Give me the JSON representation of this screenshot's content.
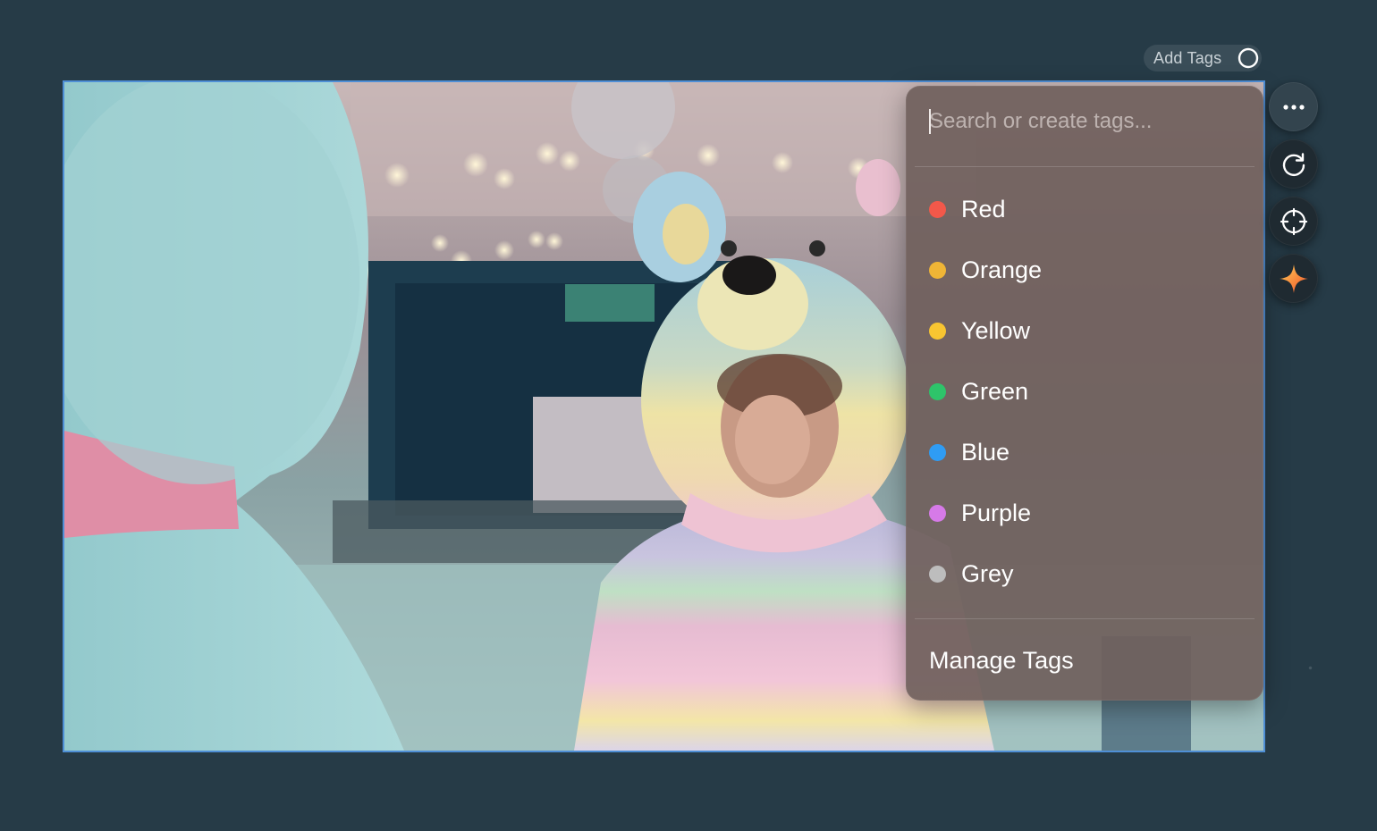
{
  "toolbar": {
    "add_tags_label": "Add Tags"
  },
  "tag_menu": {
    "search_placeholder": "Search or create tags...",
    "search_value": "",
    "tags": [
      {
        "label": "Red",
        "color": "#f2584a"
      },
      {
        "label": "Orange",
        "color": "#efb536"
      },
      {
        "label": "Yellow",
        "color": "#f8c531"
      },
      {
        "label": "Green",
        "color": "#2ec46a"
      },
      {
        "label": "Blue",
        "color": "#2f9cf4"
      },
      {
        "label": "Purple",
        "color": "#d67ae8"
      },
      {
        "label": "Grey",
        "color": "#bdbdbd"
      }
    ],
    "manage_label": "Manage Tags"
  },
  "side_actions": [
    {
      "icon": "more-horizontal-icon"
    },
    {
      "icon": "refresh-icon"
    },
    {
      "icon": "crosshair-icon"
    },
    {
      "icon": "sparkle-icon"
    }
  ],
  "colors": {
    "canvas_bg": "#263b47",
    "selection_border": "#4f8fd6",
    "menu_bg": "#70605c",
    "sparkle_accent": "#f47a38"
  }
}
